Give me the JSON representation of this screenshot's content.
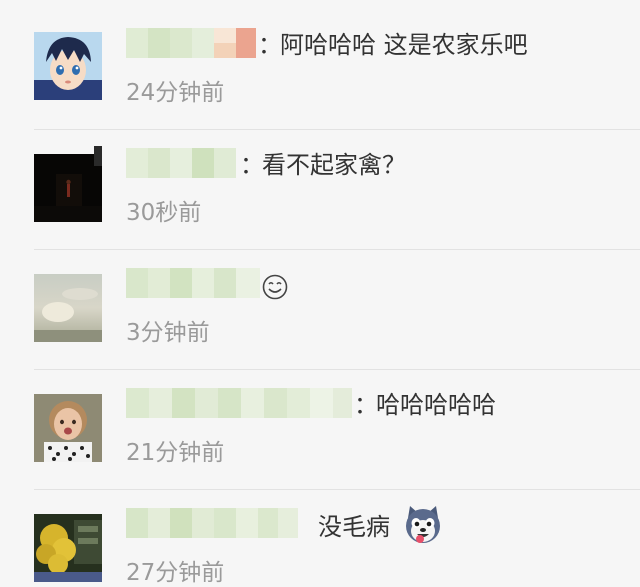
{
  "comments": [
    {
      "user_avatar": "anime-boy-avatar",
      "separator": "：",
      "text": "阿哈哈哈 这是农家乐吧",
      "time": "24分钟前",
      "emoji": ""
    },
    {
      "user_avatar": "dark-stage-avatar",
      "separator": "：",
      "text": "看不起家禽？",
      "time": "30秒前",
      "emoji": ""
    },
    {
      "user_avatar": "sky-landscape-avatar",
      "separator": "",
      "text": "",
      "time": "3分钟前",
      "emoji": "smile-emoji"
    },
    {
      "user_avatar": "girl-photo-avatar",
      "separator": "：",
      "text": "哈哈哈哈哈",
      "time": "21分钟前",
      "emoji": ""
    },
    {
      "user_avatar": "yellow-tree-avatar",
      "separator": "",
      "text": "没毛病",
      "time": "27分钟前",
      "emoji": "husky-emoji"
    }
  ],
  "colors": {
    "background": "#f6f6f6",
    "text": "#333333",
    "time": "#9a9a9a",
    "divider": "#e2e2e2",
    "blur_green": "#d6e6c6"
  }
}
